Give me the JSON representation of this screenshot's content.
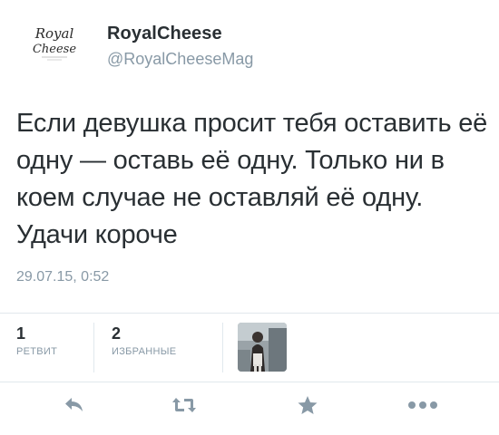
{
  "tweet": {
    "display_name": "RoyalCheese",
    "screen_name": "@RoyalCheeseMag",
    "text": "Если девушка просит тебя оставить её одну — оставь её одну. Только ни в коем случае не оставляй её одну. Удачи короче",
    "timestamp": "29.07.15, 0:52"
  },
  "stats": {
    "retweets": {
      "count": "1",
      "label": "РЕТВИТ"
    },
    "favorites": {
      "count": "2",
      "label": "ИЗБРАННЫЕ"
    }
  },
  "actions": {
    "icons": [
      "reply-icon",
      "retweet-icon",
      "favorite-star-icon",
      "more-dots-icon"
    ]
  },
  "colors": {
    "text": "#292f33",
    "muted": "#8899a6",
    "divider": "#e1e8ed",
    "icon": "#8899a6"
  }
}
